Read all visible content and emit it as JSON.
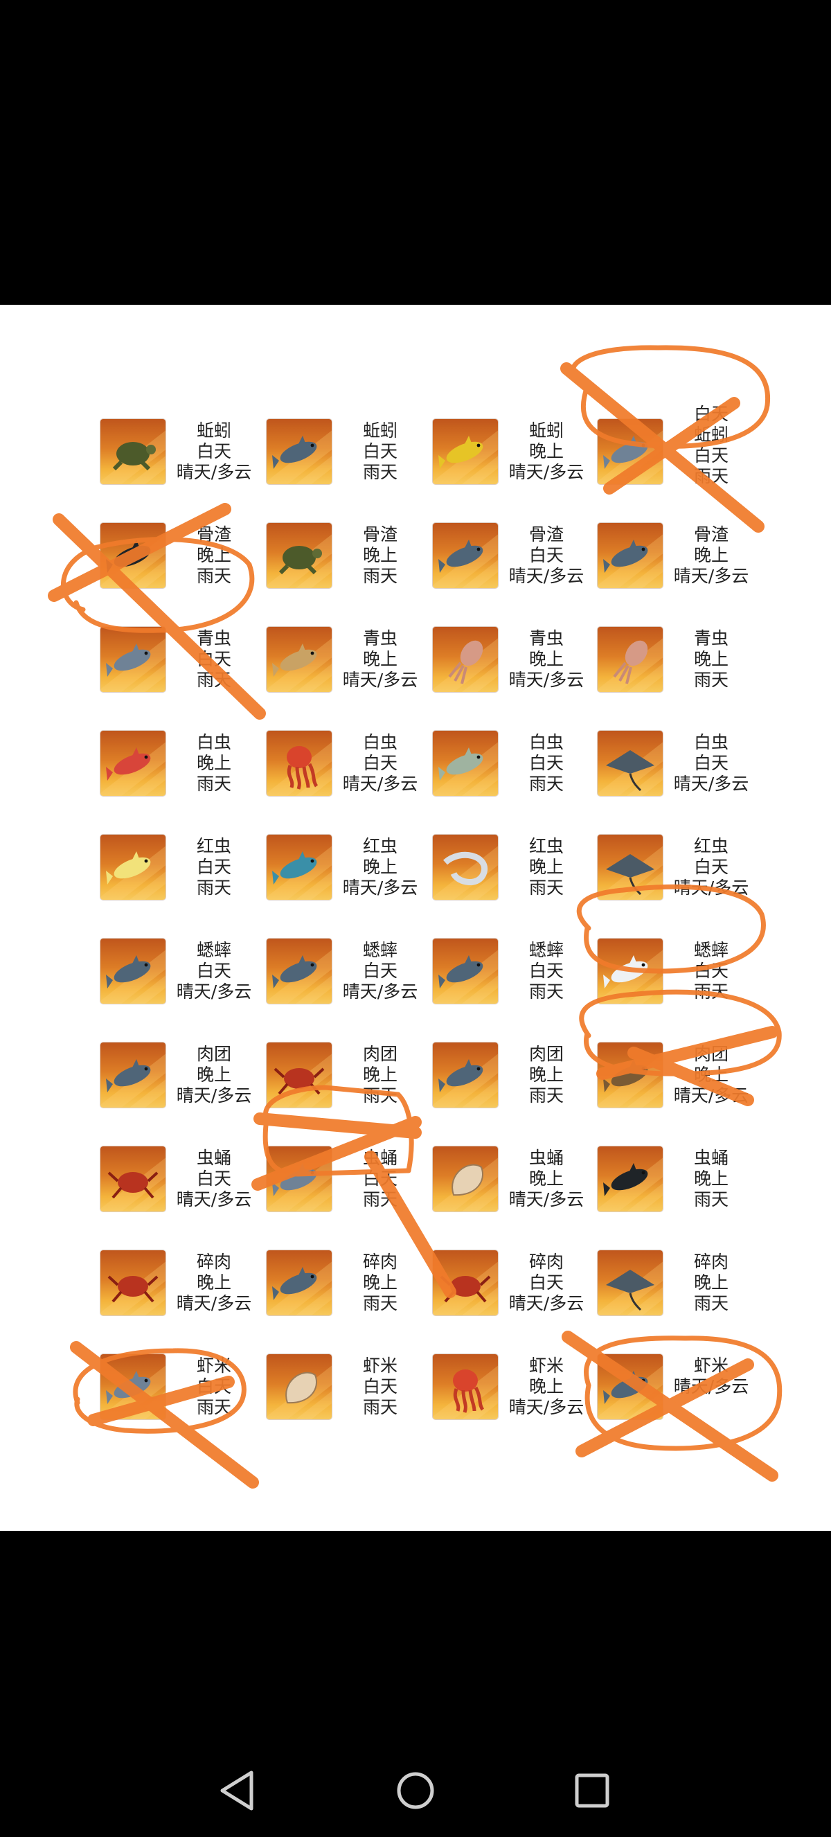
{
  "colors": {
    "annotation": "#f07b2b",
    "thumb_top": "#c0561c",
    "thumb_bottom": "#f7c95c"
  },
  "fish_grid": [
    [
      {
        "icon": "turtle-icon",
        "bait": "蚯蚓",
        "time": "白天",
        "weather": "晴天/多云"
      },
      {
        "icon": "shark-icon",
        "bait": "蚯蚓",
        "time": "白天",
        "weather": "雨天"
      },
      {
        "icon": "tropical-fish-icon",
        "bait": "蚯蚓",
        "time": "晚上",
        "weather": "晴天/多云"
      },
      {
        "icon": "swordfish-icon",
        "bait": "蚯蚓",
        "time": "白天",
        "weather": "雨天",
        "extra": "白天"
      }
    ],
    [
      {
        "icon": "orca-icon",
        "bait": "骨渣",
        "time": "晚上",
        "weather": "雨天"
      },
      {
        "icon": "sea-turtle-icon",
        "bait": "骨渣",
        "time": "晚上",
        "weather": "雨天"
      },
      {
        "icon": "tuna-icon",
        "bait": "骨渣",
        "time": "白天",
        "weather": "晴天/多云"
      },
      {
        "icon": "whale-icon",
        "bait": "骨渣",
        "time": "晚上",
        "weather": "晴天/多云"
      }
    ],
    [
      {
        "icon": "marlin-icon",
        "bait": "青虫",
        "time": "白天",
        "weather": "雨天"
      },
      {
        "icon": "flounder-icon",
        "bait": "青虫",
        "time": "晚上",
        "weather": "晴天/多云"
      },
      {
        "icon": "squid-icon",
        "bait": "青虫",
        "time": "晚上",
        "weather": "晴天/多云"
      },
      {
        "icon": "seadragon-icon",
        "bait": "青虫",
        "time": "晚上",
        "weather": "雨天"
      }
    ],
    [
      {
        "icon": "grouper-icon",
        "bait": "白虫",
        "time": "晚上",
        "weather": "雨天"
      },
      {
        "icon": "jellyfish-icon",
        "bait": "白虫",
        "time": "白天",
        "weather": "晴天/多云"
      },
      {
        "icon": "trout-icon",
        "bait": "白虫",
        "time": "白天",
        "weather": "雨天"
      },
      {
        "icon": "manta-ray-icon",
        "bait": "白虫",
        "time": "白天",
        "weather": "晴天/多云"
      }
    ],
    [
      {
        "icon": "butterflyfish-icon",
        "bait": "红虫",
        "time": "白天",
        "weather": "雨天"
      },
      {
        "icon": "discus-icon",
        "bait": "红虫",
        "time": "晚上",
        "weather": "晴天/多云"
      },
      {
        "icon": "eel-icon",
        "bait": "红虫",
        "time": "晚上",
        "weather": "雨天"
      },
      {
        "icon": "stingray-icon",
        "bait": "红虫",
        "time": "白天",
        "weather": "晴天/多云"
      }
    ],
    [
      {
        "icon": "striped-shark-icon",
        "bait": "蟋蟀",
        "time": "白天",
        "weather": "晴天/多云"
      },
      {
        "icon": "humpback-icon",
        "bait": "蟋蟀",
        "time": "白天",
        "weather": "晴天/多云"
      },
      {
        "icon": "whale-shark-icon",
        "bait": "蟋蟀",
        "time": "白天",
        "weather": "雨天"
      },
      {
        "icon": "beluga-icon",
        "bait": "蟋蟀",
        "time": "白天",
        "weather": "雨天"
      }
    ],
    [
      {
        "icon": "leopard-shark-icon",
        "bait": "肉团",
        "time": "晚上",
        "weather": "晴天/多云"
      },
      {
        "icon": "crab-icon",
        "bait": "肉团",
        "time": "晚上",
        "weather": "雨天"
      },
      {
        "icon": "dolphin-icon",
        "bait": "肉团",
        "time": "晚上",
        "weather": "雨天"
      },
      {
        "icon": "sea-lion-icon",
        "bait": "肉团",
        "time": "晚上",
        "weather": "晴天/多云"
      }
    ],
    [
      {
        "icon": "lobster-icon",
        "bait": "虫蛹",
        "time": "白天",
        "weather": "晴天/多云"
      },
      {
        "icon": "sea-cucumber-icon",
        "bait": "虫蛹",
        "time": "白天",
        "weather": "雨天"
      },
      {
        "icon": "conch-icon",
        "bait": "虫蛹",
        "time": "晚上",
        "weather": "晴天/多云"
      },
      {
        "icon": "killer-whale-icon",
        "bait": "虫蛹",
        "time": "晚上",
        "weather": "雨天"
      }
    ],
    [
      {
        "icon": "spider-crab-icon",
        "bait": "碎肉",
        "time": "晚上",
        "weather": "晴天/多云"
      },
      {
        "icon": "blue-shark-icon",
        "bait": "碎肉",
        "time": "晚上",
        "weather": "雨天"
      },
      {
        "icon": "red-crab-icon",
        "bait": "碎肉",
        "time": "白天",
        "weather": "晴天/多云"
      },
      {
        "icon": "spotted-ray-icon",
        "bait": "碎肉",
        "time": "晚上",
        "weather": "雨天"
      }
    ],
    [
      {
        "icon": "sailfish-icon",
        "bait": "虾米",
        "time": "白天",
        "weather": "雨天"
      },
      {
        "icon": "shell-icon",
        "bait": "虾米",
        "time": "白天",
        "weather": "雨天"
      },
      {
        "icon": "octopus-icon",
        "bait": "虾米",
        "time": "晚上",
        "weather": "晴天/多云"
      },
      {
        "icon": "dolphin-icon",
        "bait": "虾米",
        "time": "晴天/多云",
        "weather": ""
      }
    ]
  ],
  "nav": {
    "back": "back-icon",
    "home": "home-icon",
    "recent": "recent-apps-icon"
  }
}
